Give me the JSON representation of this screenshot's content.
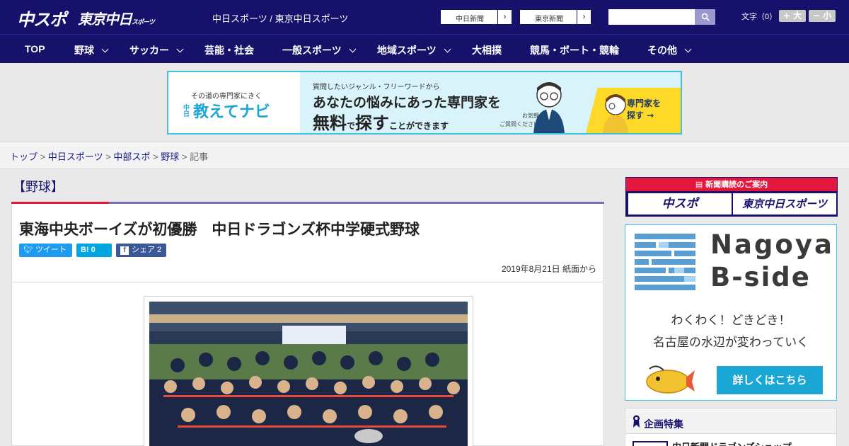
{
  "header": {
    "logo_chuspo": "中スポ",
    "logo_tokyo": "東京中日",
    "logo_tokyo_small": "スポーツ",
    "site_name": "中日スポーツ / 東京中日スポーツ",
    "btn_chunichi": "中日新聞",
    "btn_tokyo": "東京新聞",
    "arrow": "›",
    "search_placeholder": "",
    "font_size_label": "文字（0）",
    "font_large": "+ 大",
    "font_small": "− 小"
  },
  "nav": {
    "items": [
      {
        "label": "TOP"
      },
      {
        "label": "野球"
      },
      {
        "label": "サッカー"
      },
      {
        "label": "芸能・社会"
      },
      {
        "label": "一般スポーツ"
      },
      {
        "label": "地域スポーツ"
      },
      {
        "label": "大相撲"
      },
      {
        "label": "競馬・ボート・競輪"
      },
      {
        "label": "その他"
      }
    ]
  },
  "banner": {
    "tag": "その道の専門家にきく",
    "logo_small": "中日",
    "logo": "教えてナビ",
    "sub": "質問したいジャンル・フリーワードから",
    "main1": "あなたの悩みにあった専門家を",
    "main2_a": "無料",
    "main2_b": "で",
    "main2_c": "探す",
    "main2_d": "ことができます",
    "note1": "お気軽に",
    "note2": "ご質問ください！",
    "cta1": "専門家を",
    "cta2": "探す →",
    "colors": {
      "accent": "#3cc1e3",
      "cta": "#ffd927"
    }
  },
  "breadcrumb": {
    "items": [
      "トップ",
      "中日スポーツ",
      "中部スポ",
      "野球"
    ],
    "separator": " > ",
    "current": "記事"
  },
  "article": {
    "category": "【野球】",
    "headline": "東海中央ボーイズが初優勝　中日ドラゴンズ杯中学硬式野球",
    "tweet_label": "ツイート",
    "hatena_label": "B! 0",
    "share_label": "シェア 2",
    "dateline": "2019年8月21日 紙面から"
  },
  "sidebar": {
    "subscribe_head": "新聞購読のご案内",
    "subscribe_chuspo": "中スポ",
    "subscribe_tokyo": "東京中日スポーツ",
    "bside_title1": "Nagoya",
    "bside_title2": "B-side",
    "bside_tag1": "わくわく！どきどき！",
    "bside_tag2": "名古屋の水辺が変わっていく",
    "bside_cta": "詳しくはこちら",
    "special_title": "企画特集",
    "special_item": "中日新聞ドラゴンズショップ"
  },
  "colors": {
    "brand_navy": "#16126b",
    "brand_red": "#e2173d",
    "accent_cyan": "#3cc1e3"
  }
}
